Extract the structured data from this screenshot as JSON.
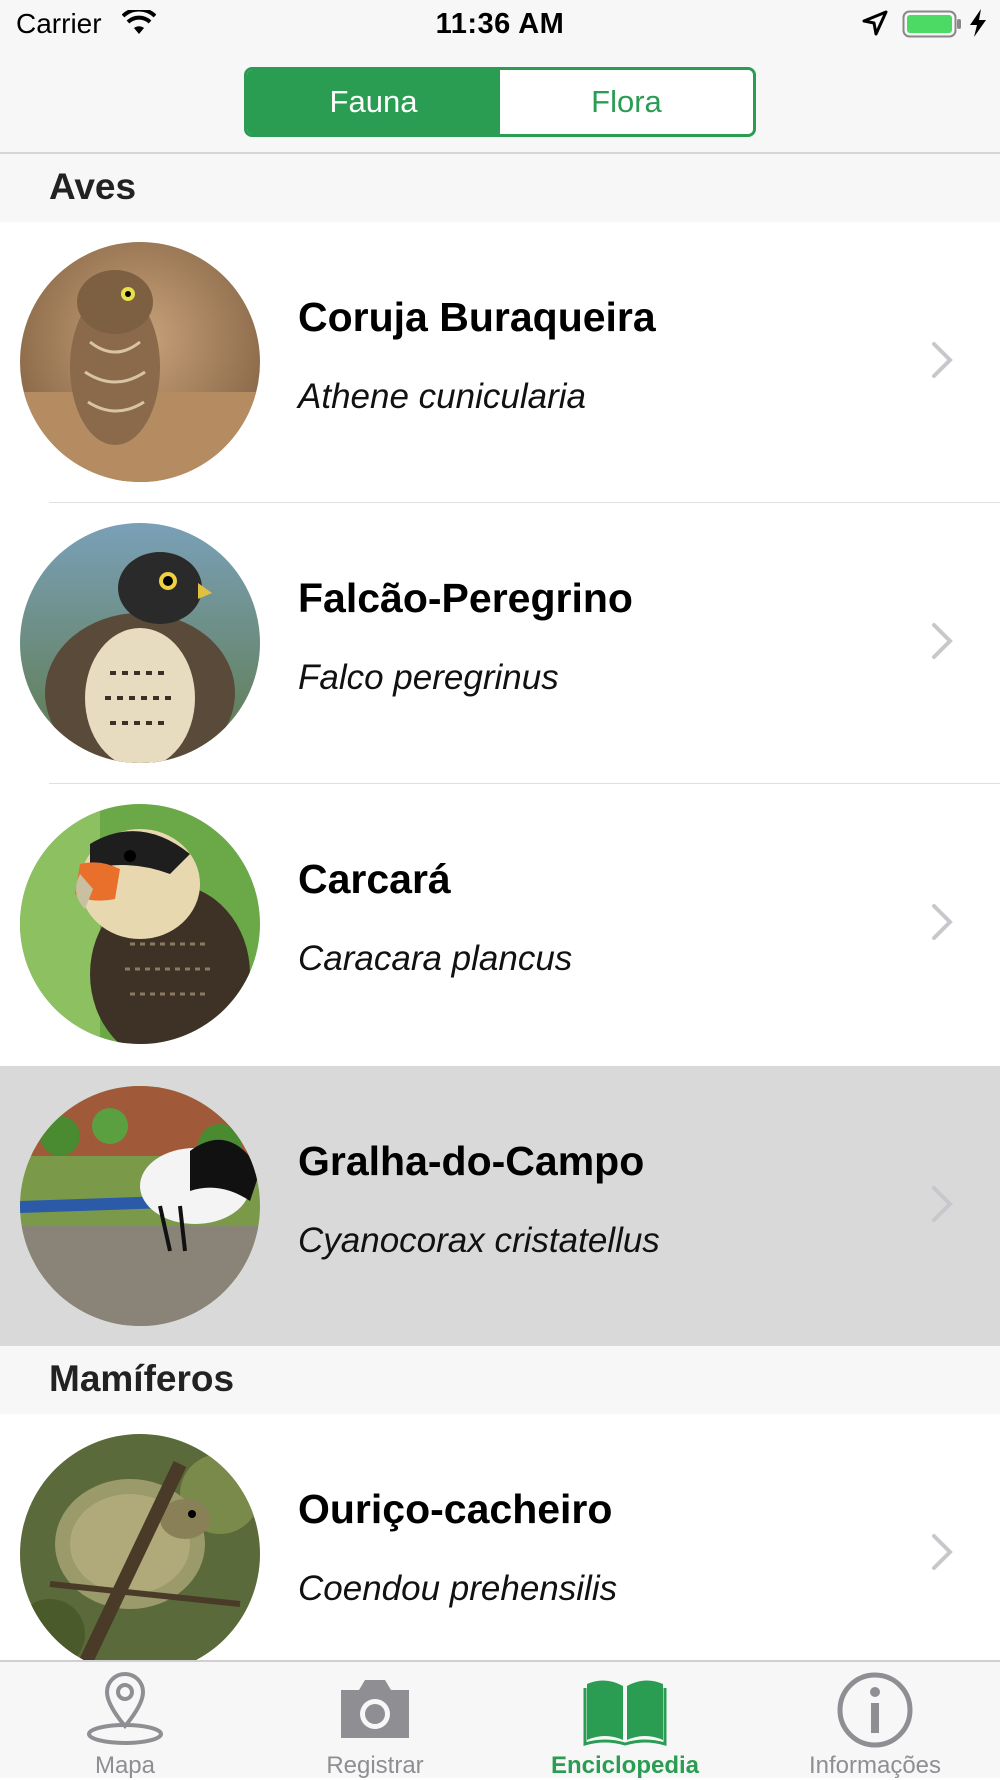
{
  "status_bar": {
    "carrier": "Carrier",
    "time": "11:36 AM",
    "battery_color": "#4cd964"
  },
  "segmented_control": {
    "options": [
      "Fauna",
      "Flora"
    ],
    "selected": "Fauna",
    "accent_color": "#2a9d52"
  },
  "sections": [
    {
      "title": "Aves",
      "items": [
        {
          "name": "Coruja Buraqueira",
          "scientific": "Athene cunicularia",
          "image_icon": "owl-photo"
        },
        {
          "name": "Falcão-Peregrino",
          "scientific": "Falco peregrinus",
          "image_icon": "falcon-photo"
        },
        {
          "name": "Carcará",
          "scientific": "Caracara plancus",
          "image_icon": "caracara-photo"
        },
        {
          "name": "Gralha-do-Campo",
          "scientific": "Cyanocorax cristatellus",
          "image_icon": "jay-photo",
          "highlighted": true
        }
      ]
    },
    {
      "title": "Mamíferos",
      "items": [
        {
          "name": "Ouriço-cacheiro",
          "scientific": "Coendou prehensilis",
          "image_icon": "porcupine-photo"
        }
      ]
    }
  ],
  "tab_bar": {
    "tabs": [
      {
        "label": "Mapa",
        "icon": "map-pin-icon"
      },
      {
        "label": "Registrar",
        "icon": "camera-icon"
      },
      {
        "label": "Enciclopedia",
        "icon": "book-icon",
        "active": true
      },
      {
        "label": "Informações",
        "icon": "info-icon"
      }
    ],
    "active_color": "#2a9d52",
    "inactive_color": "#8e8e93"
  }
}
